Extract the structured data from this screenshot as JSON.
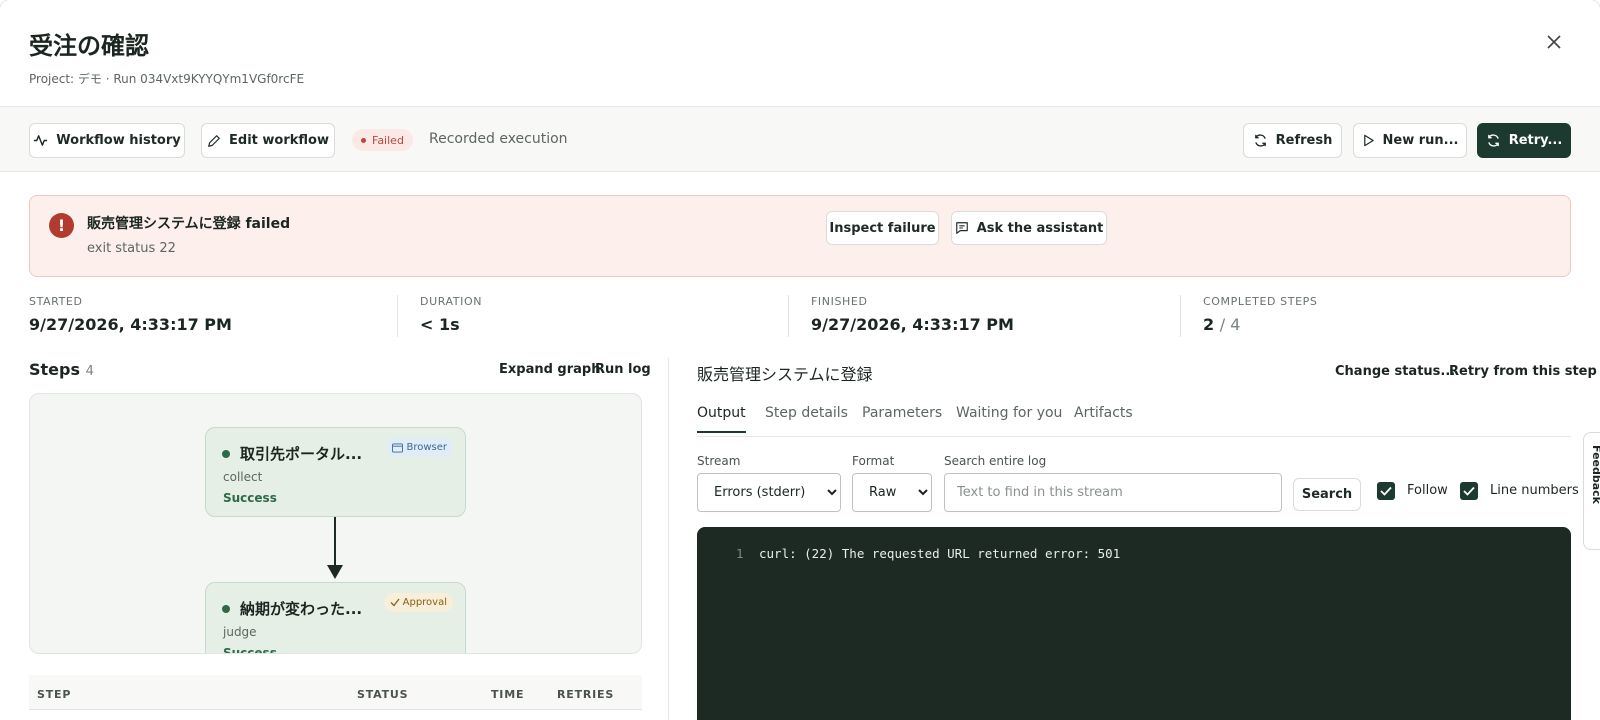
{
  "header": {
    "title": "受注の確認",
    "subtitle": "Project: デモ · Run 034Vxt9KYYQYm1VGf0rcFE"
  },
  "toolbar": {
    "workflow_history": "Workflow history",
    "edit_workflow": "Edit workflow",
    "status_badge": "Failed",
    "recorded": "Recorded execution",
    "refresh": "Refresh",
    "new_run": "New run...",
    "retry": "Retry..."
  },
  "alert": {
    "title": "販売管理システムに登録 failed",
    "detail": "exit status 22",
    "inspect": "Inspect failure",
    "ask": "Ask the assistant"
  },
  "stats": {
    "started_label": "STARTED",
    "started_value": "9/27/2026, 4:33:17 PM",
    "duration_label": "DURATION",
    "duration_value": "< 1s",
    "finished_label": "FINISHED",
    "finished_value": "9/27/2026, 4:33:17 PM",
    "completed_label": "COMPLETED STEPS",
    "completed_done": "2",
    "completed_total": "/ 4"
  },
  "steps": {
    "title": "Steps",
    "count": "4",
    "expand_graph": "Expand graph",
    "run_log": "Run log",
    "nodes": [
      {
        "title": "取引先ポータル...",
        "type": "collect",
        "status": "Success",
        "tag": "Browser"
      },
      {
        "title": "納期が変わった...",
        "type": "judge",
        "status": "Success",
        "tag": "Approval"
      }
    ],
    "columns": [
      "STEP",
      "STATUS",
      "TIME",
      "RETRIES"
    ]
  },
  "detail": {
    "title": "販売管理システムに登録",
    "change_status": "Change status...",
    "retry_from_step": "Retry from this step",
    "tabs": [
      "Output",
      "Step details",
      "Parameters",
      "Waiting for you",
      "Artifacts"
    ],
    "active_tab": "Output",
    "stream_label": "Stream",
    "stream_value": "Errors (stderr)",
    "format_label": "Format",
    "format_value": "Raw",
    "search_label": "Search entire log",
    "search_placeholder": "Text to find in this stream",
    "search_button": "Search",
    "follow_label": "Follow",
    "follow_checked": true,
    "line_numbers_label": "Line numbers",
    "line_numbers_checked": true,
    "log_lines": [
      {
        "n": "1",
        "text": "curl: (22) The requested URL returned error: 501"
      }
    ]
  },
  "feedback": "Feedback"
}
